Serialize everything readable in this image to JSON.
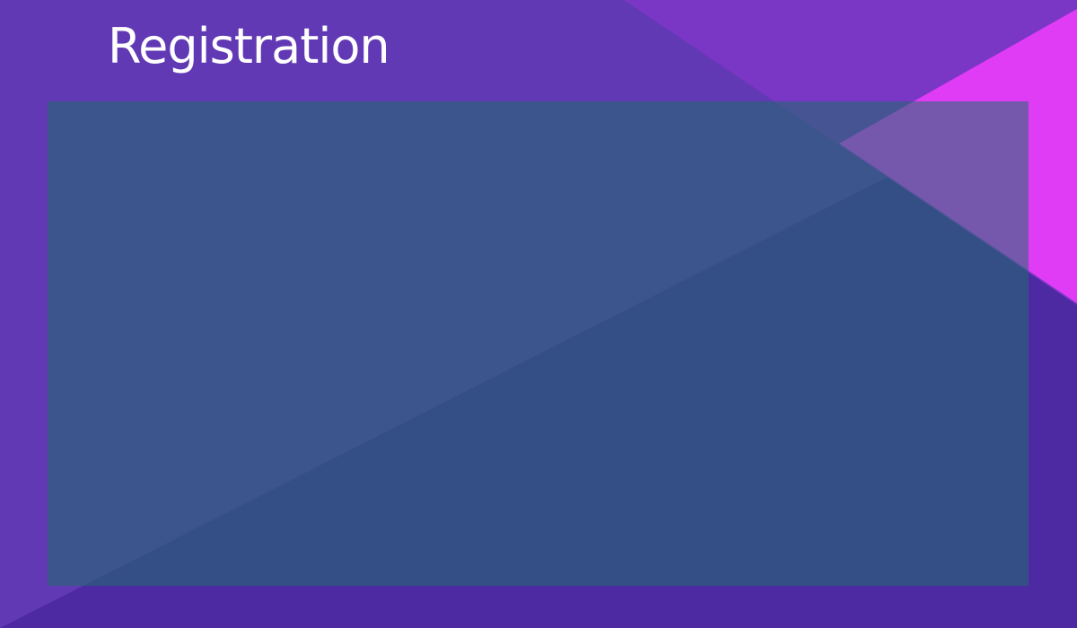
{
  "page": {
    "title": "Registration"
  },
  "colors": {
    "background_main": "#6239b4",
    "background_lower": "#4e2aa2",
    "accent_magenta": "#e03cf5",
    "accent_violet": "#7a36c4",
    "panel_tint": "#355a7b",
    "title_text": "#ffffff"
  }
}
